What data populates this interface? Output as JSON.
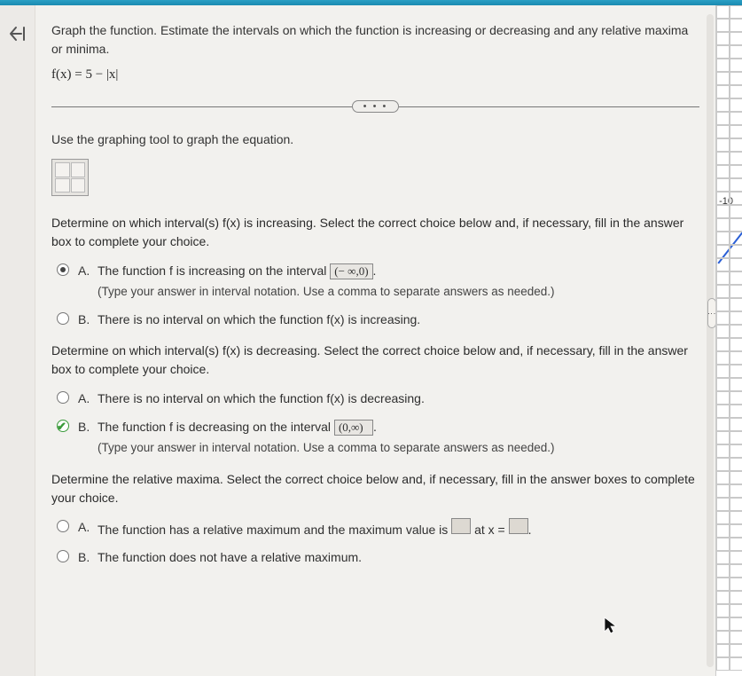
{
  "question": {
    "intro": "Graph the function. Estimate the intervals on which the function is increasing or decreasing and any relative maxima or minima.",
    "equation": "f(x) = 5 − |x|"
  },
  "divider_label": "• • •",
  "graph_instruction": "Use the graphing tool to graph the equation.",
  "section_increasing": {
    "prompt": "Determine on which interval(s) f(x) is increasing. Select the correct choice below and, if necessary, fill in the answer box to complete your choice.",
    "choice_a": {
      "letter": "A.",
      "text_before": "The function f is increasing on the interval ",
      "answer": "(− ∞,0)",
      "text_after": ".",
      "hint": "(Type your answer in interval notation. Use a comma to separate answers as needed.)"
    },
    "choice_b": {
      "letter": "B.",
      "text": "There is no interval on which the function f(x) is increasing."
    }
  },
  "section_decreasing": {
    "prompt": "Determine on which interval(s) f(x) is decreasing. Select the correct choice below and, if necessary, fill in the answer box to complete your choice.",
    "choice_a": {
      "letter": "A.",
      "text": "There is no interval on which the function f(x) is decreasing."
    },
    "choice_b": {
      "letter": "B.",
      "text_before": "The function f is decreasing on the interval ",
      "answer": "(0,∞)",
      "text_after": ".",
      "hint": "(Type your answer in interval notation. Use a comma to separate answers as needed.)"
    }
  },
  "section_maxima": {
    "prompt": "Determine the relative maxima. Select the correct choice below and, if necessary, fill in the answer boxes to complete your choice.",
    "choice_a": {
      "letter": "A.",
      "text_before": "The function has a relative maximum and the maximum value is ",
      "between": " at x = ",
      "text_after": "."
    },
    "choice_b": {
      "letter": "B.",
      "text": "The function does not have a relative maximum."
    }
  },
  "graph_panel": {
    "axis_tick": "-10"
  }
}
